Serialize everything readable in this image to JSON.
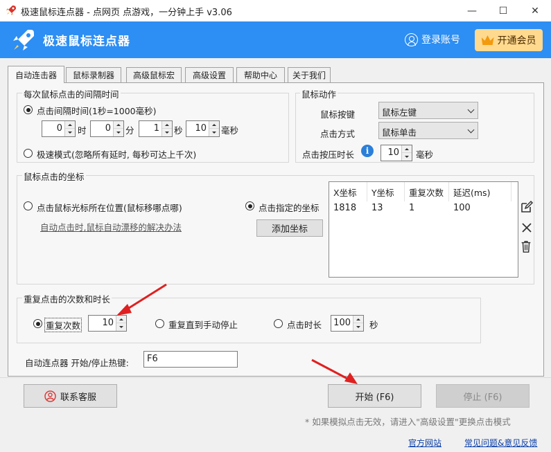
{
  "window": {
    "title": "极速鼠标连点器 - 点网页 点游戏，一分钟上手 v3.06",
    "minimize_glyph": "—",
    "maximize_glyph": "☐",
    "close_glyph": "✕"
  },
  "header": {
    "brand": "极速鼠标连点器",
    "login_label": "登录账号",
    "vip_label": "开通会员"
  },
  "tabs": [
    {
      "label": "自动连击器",
      "active": true
    },
    {
      "label": "鼠标录制器",
      "active": false
    },
    {
      "label": "高级鼠标宏",
      "active": false
    },
    {
      "label": "高级设置",
      "active": false
    },
    {
      "label": "帮助中心",
      "active": false
    },
    {
      "label": "关于我们",
      "active": false
    }
  ],
  "interval": {
    "legend": "每次鼠标点击的间隔时间",
    "option_interval": "点击间隔时间(1秒=1000毫秒)",
    "hours_value": "0",
    "hours_unit": "时",
    "minutes_value": "0",
    "minutes_unit": "分",
    "seconds_value": "1",
    "seconds_unit": "秒",
    "ms_value": "10",
    "ms_unit": "毫秒",
    "option_fast": "极速模式(忽略所有延时, 每秒可达上千次)"
  },
  "action": {
    "legend": "鼠标动作",
    "button_label": "鼠标按键",
    "button_value": "鼠标左键",
    "mode_label": "点击方式",
    "mode_value": "鼠标单击",
    "press_label": "点击按压时长",
    "press_value": "10",
    "press_unit": "毫秒",
    "info_glyph": "i"
  },
  "coords": {
    "legend": "鼠标点击的坐标",
    "option_cursor": "点击鼠标光标所在位置(鼠标移哪点哪)",
    "help_link": "自动点击时,鼠标自动漂移的解决办法",
    "option_specified": "点击指定的坐标",
    "add_button": "添加坐标",
    "columns": [
      "X坐标",
      "Y坐标",
      "重复次数",
      "延迟(ms)"
    ],
    "rows": [
      [
        "1818",
        "13",
        "1",
        "100"
      ]
    ]
  },
  "repeat": {
    "legend": "重复点击的次数和时长",
    "option_count": "重复次数",
    "count_value": "10",
    "option_manual": "重复直到手动停止",
    "option_duration": "点击时长",
    "duration_value": "100",
    "duration_unit": "秒"
  },
  "hotkey": {
    "label": "自动连点器 开始/停止热键:",
    "value": "F6"
  },
  "footer": {
    "support_button": "联系客服",
    "start_button": "开始 (F6)",
    "stop_button": "停止 (F6)",
    "note": "* 如果模拟点击无效，请进入\"高级设置\"更换点击模式",
    "official_link": "官方网站",
    "faq_link": "常见问题&意见反馈"
  },
  "colors": {
    "header_blue": "#2d8ef3",
    "vip_gold": "#ffd98e",
    "annotation_red": "#e02020",
    "info_blue": "#2b7fd8"
  }
}
